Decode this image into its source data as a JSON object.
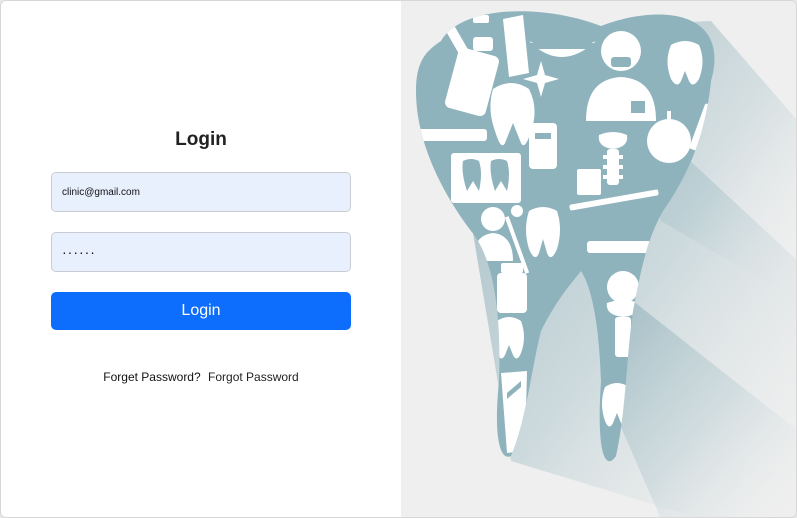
{
  "login": {
    "title": "Login",
    "email_value": "clinic@gmail.com",
    "password_value": "······",
    "button_label": "Login",
    "forget_text": "Forget Password?",
    "forgot_link": "Forgot Password"
  },
  "colors": {
    "primary": "#0d6efd",
    "input_bg": "#e8f0fe",
    "illustration_teal": "#8eb3bd",
    "right_bg": "#efefef"
  },
  "illustration": {
    "subject": "tooth-shaped collage of dental icons",
    "icons": [
      "toothbrush-icon",
      "toothpaste-icon",
      "dentist-icon",
      "tooth-icon",
      "syringe-icon",
      "apple-icon",
      "mouthwash-icon",
      "dental-implant-icon",
      "braces-icon",
      "mirror-icon",
      "floss-icon"
    ]
  }
}
